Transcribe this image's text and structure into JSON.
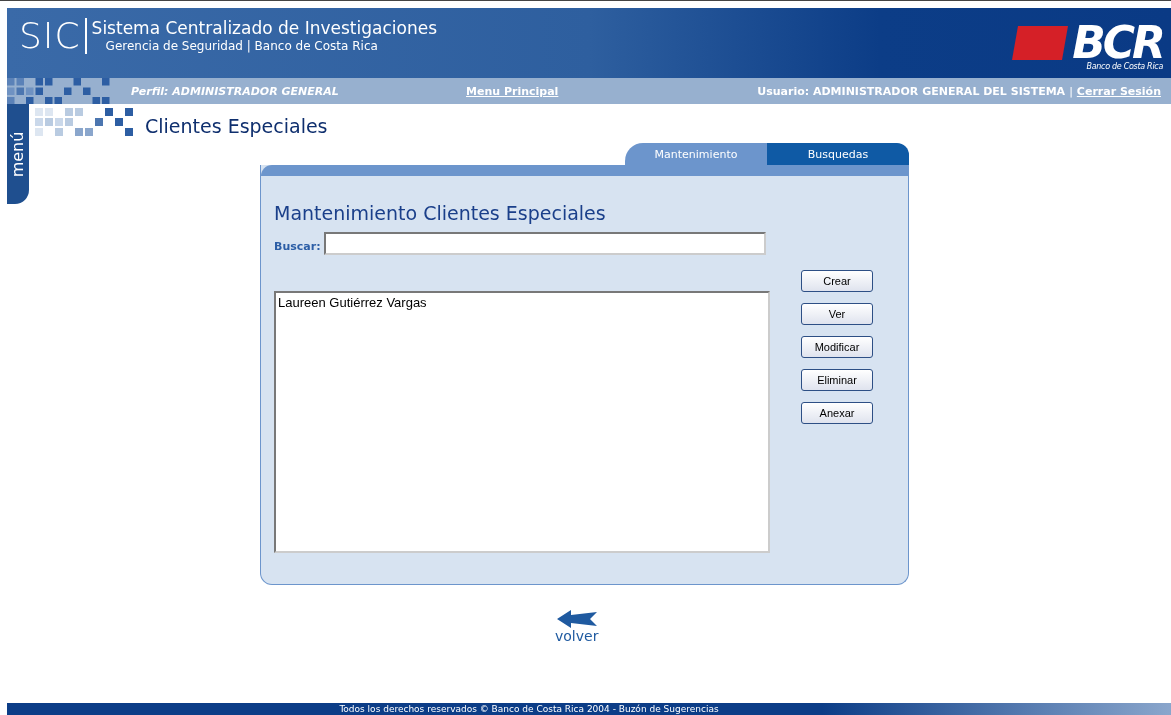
{
  "header": {
    "logo": "SIC",
    "title": "Sistema Centralizado de Investigaciones",
    "subtitle": "Gerencia de Seguridad | Banco de Costa Rica",
    "bank_logo": "BCR",
    "bank_name": "Banco de Costa Rica"
  },
  "nav": {
    "profile": "Perfil: ADMINISTRADOR GENERAL",
    "main_menu": "Menu Principal",
    "user": "Usuario: ADMINISTRADOR GENERAL DEL SISTEMA",
    "separator": "|",
    "logout": "Cerrar Sesión"
  },
  "side_tab": "menú",
  "page_title": "Clientes Especiales",
  "tabs": [
    {
      "label": "Mantenimiento",
      "selected": true
    },
    {
      "label": "Busquedas",
      "selected": false
    }
  ],
  "panel": {
    "title": "Mantenimiento Clientes Especiales",
    "search_label": "Buscar:",
    "list_items": [
      {
        "label": "Laureen Gutiérrez Vargas",
        "selected": false
      }
    ],
    "buttons": [
      "Crear",
      "Ver",
      "Modificar",
      "Eliminar",
      "Anexar"
    ]
  },
  "back": "volver",
  "footer": "Todos los derechos reservados © Banco de Costa Rica 2004 - Buzón de Sugerencias"
}
